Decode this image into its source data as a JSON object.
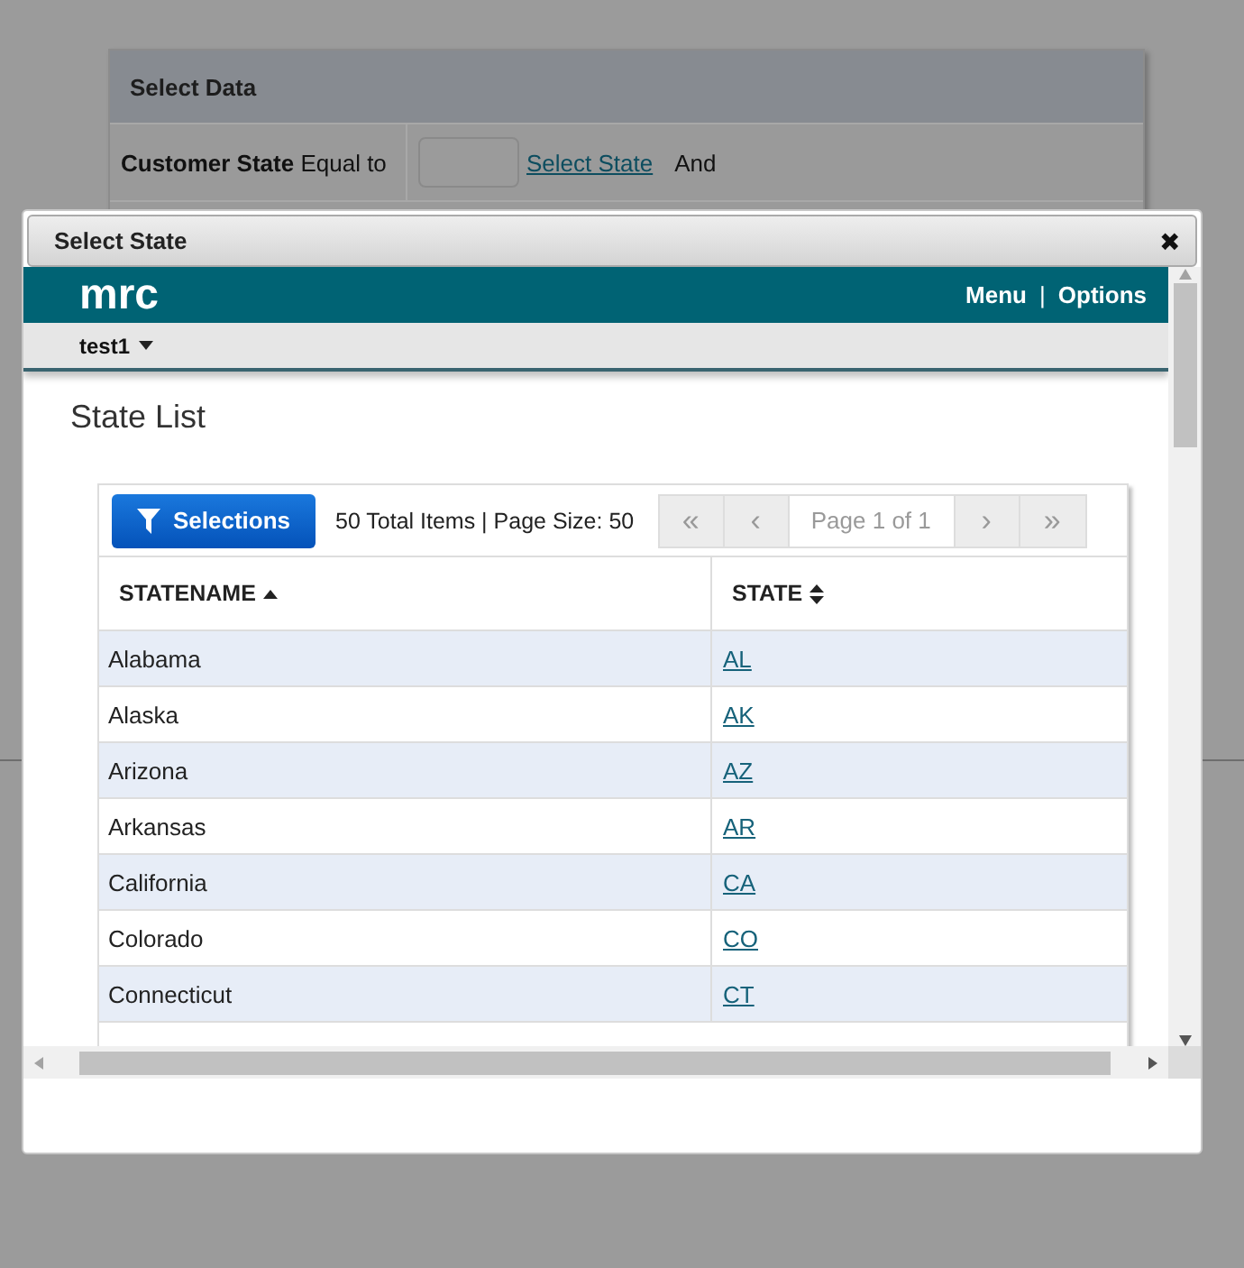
{
  "background": {
    "panel_title": "Select Data",
    "filter_row": {
      "label_bold": "Customer State",
      "label_rest": "Equal to",
      "link": "Select State",
      "conjunction": "And"
    }
  },
  "dialog": {
    "title": "Select State",
    "close": "✖",
    "app_bar": {
      "logo": "mrc",
      "links": [
        "Menu",
        "Options"
      ],
      "separator": "|"
    },
    "user_menu": {
      "label": "test1"
    },
    "heading": "State List",
    "grid": {
      "selections_button": "Selections",
      "summary": "50 Total Items | Page Size: 50",
      "pager": {
        "first": "«",
        "prev": "‹",
        "page": "Page 1 of 1",
        "next": "›",
        "last": "»"
      },
      "columns": [
        {
          "label": "STATENAME",
          "sorted": true
        },
        {
          "label": "STATE",
          "sorted": false
        }
      ],
      "rows": [
        {
          "name": "Alabama",
          "code": "AL"
        },
        {
          "name": "Alaska",
          "code": "AK"
        },
        {
          "name": "Arizona",
          "code": "AZ"
        },
        {
          "name": "Arkansas",
          "code": "AR"
        },
        {
          "name": "California",
          "code": "CA"
        },
        {
          "name": "Colorado",
          "code": "CO"
        },
        {
          "name": "Connecticut",
          "code": "CT"
        }
      ]
    }
  }
}
